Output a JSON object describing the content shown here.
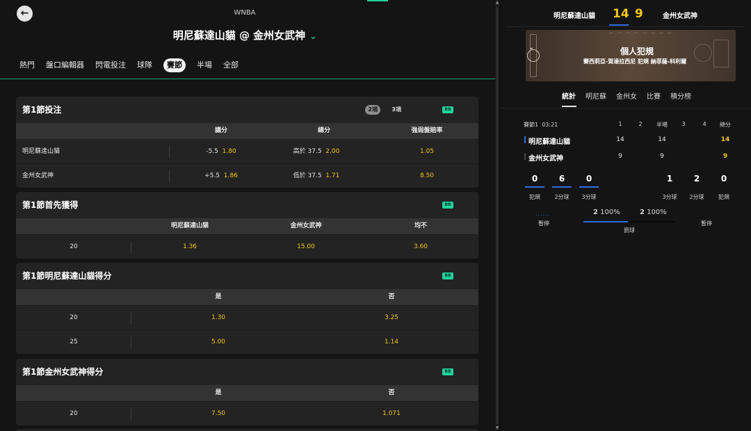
{
  "header": {
    "league": "WNBA",
    "match_title": "明尼蘇達山貓 @ 金州女武神",
    "back_icon": "arrow-left-icon",
    "expand_icon": "chevron-down-icon"
  },
  "tabs": [
    {
      "label": "熱門"
    },
    {
      "label": "盤口編輯器"
    },
    {
      "label": "閃電投注"
    },
    {
      "label": "球隊"
    },
    {
      "label": "賽節",
      "active": true
    },
    {
      "label": "半場"
    },
    {
      "label": "全部"
    }
  ],
  "markets": {
    "q1_bet": {
      "title": "第1節投注",
      "count_2": "2項",
      "count_3": "3項",
      "badge": "BB",
      "headers": [
        "讓分",
        "總分",
        "強弱盤賠率"
      ],
      "rows": [
        {
          "team": "明尼蘇達山貓",
          "spread_line": "-5.5",
          "spread_odds": "1.80",
          "total_label": "高於 37.5",
          "total_odds": "2.00",
          "ml_odds": "1.05"
        },
        {
          "team": "金州女武神",
          "spread_line": "+5.5",
          "spread_odds": "1.86",
          "total_label": "低於 37.5",
          "total_odds": "1.71",
          "ml_odds": "8.50"
        }
      ]
    },
    "q1_first": {
      "title": "第1節首先獲得",
      "badge": "BB",
      "headers": [
        "明尼蘇達山貓",
        "金州女武神",
        "均不"
      ],
      "rows": [
        {
          "line": "20",
          "home": "1.36",
          "away": "15.00",
          "none": "3.60"
        }
      ]
    },
    "q1_home_score": {
      "title": "第1節明尼蘇達山貓得分",
      "badge": "BB",
      "headers": [
        "是",
        "否"
      ],
      "rows": [
        {
          "line": "20",
          "yes": "1.30",
          "no": "3.25"
        },
        {
          "line": "25",
          "yes": "5.00",
          "no": "1.14"
        }
      ]
    },
    "q1_away_score": {
      "title": "第1節金州女武神得分",
      "badge": "BB",
      "headers": [
        "是",
        "否"
      ],
      "rows": [
        {
          "line": "20",
          "yes": "7.50",
          "no": "1.071"
        }
      ]
    }
  },
  "scoreboard": {
    "home_name": "明尼蘇達山貓",
    "away_name": "金州女武神",
    "home_score": "14",
    "away_score": "9",
    "event_title": "個人犯規",
    "event_detail": "賽西莉亞-賀達拉西尼 犯規 納菲薩-科利爾",
    "tabs": [
      "統計",
      "明尼蘇",
      "金州女",
      "比賽",
      "積分榜"
    ],
    "period_label": "賽節1",
    "clock": "03:21",
    "col_headers": [
      "1",
      "2",
      "半場",
      "3",
      "4",
      "總分"
    ],
    "home_row": {
      "name": "明尼蘇達山貓",
      "q1": "14",
      "half": "14",
      "total": "14",
      "color": "#2f6de1"
    },
    "away_row": {
      "name": "金州女武神",
      "q1": "9",
      "half": "9",
      "total": "9",
      "color": "#111111"
    },
    "home_stats": [
      {
        "value": "0",
        "label": "犯規"
      },
      {
        "value": "6",
        "label": "2分球"
      },
      {
        "value": "0",
        "label": "3分球"
      }
    ],
    "away_stats": [
      {
        "value": "1",
        "label": "3分球"
      },
      {
        "value": "2",
        "label": "2分球"
      },
      {
        "value": "0",
        "label": "犯規"
      }
    ],
    "timeouts_label": "暫停",
    "free_throws": {
      "label": "罰球",
      "home_value": "2",
      "home_pct": "100%",
      "away_value": "2",
      "away_pct": "100%"
    }
  }
}
